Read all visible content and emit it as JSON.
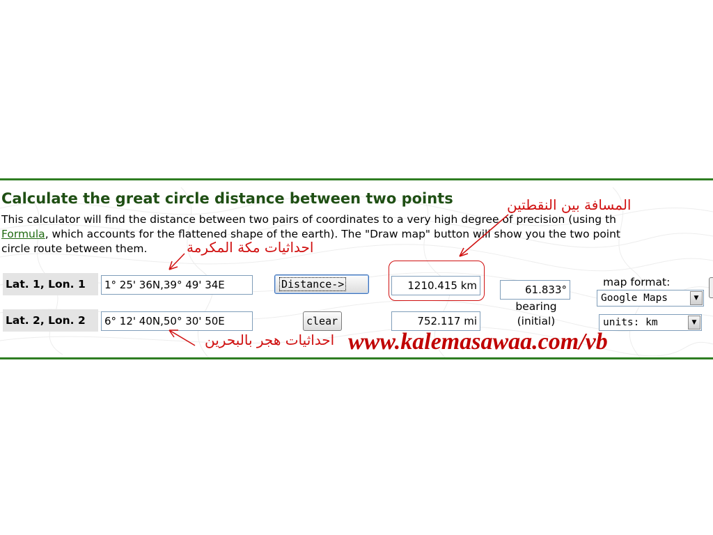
{
  "calculator": {
    "title": "Calculate the great circle distance between two points",
    "desc_line1": "This calculator will find the distance between two pairs of coordinates to a very high degree of precision (using th",
    "formula_link": "Formula",
    "desc_line2_rest": ", which accounts for the flattened shape of the earth). The \"Draw map\" button will show you the two point",
    "desc_line3": "circle route between them.",
    "row1_label": "Lat. 1, Lon. 1",
    "row1_value": "1° 25' 36N,39° 49' 34E",
    "row2_label": "Lat. 2, Lon. 2",
    "row2_value": "6° 12' 40N,50° 30' 50E",
    "distance_button": "Distance->",
    "clear_button": "clear",
    "distance_km": "1210.415 km",
    "distance_mi": "752.117 mi",
    "bearing_value": "61.833°",
    "bearing_label_line1": "bearing",
    "bearing_label_line2": "(initial)",
    "map_format_label": "map format:",
    "map_format_selected": "Google Maps",
    "units_selected": "units: km"
  },
  "annotations": {
    "distance_note": "المسافة بين النقطتين",
    "point1_note": "احداثيات مكة المكرمة",
    "point2_note": "احداثيات هجر بالبحرين",
    "watermark": "www.kalemasawaa.com/vb"
  },
  "colors": {
    "accent_green": "#2e7d22",
    "annotation_red": "#d01010",
    "watermark_red": "#c00000"
  }
}
